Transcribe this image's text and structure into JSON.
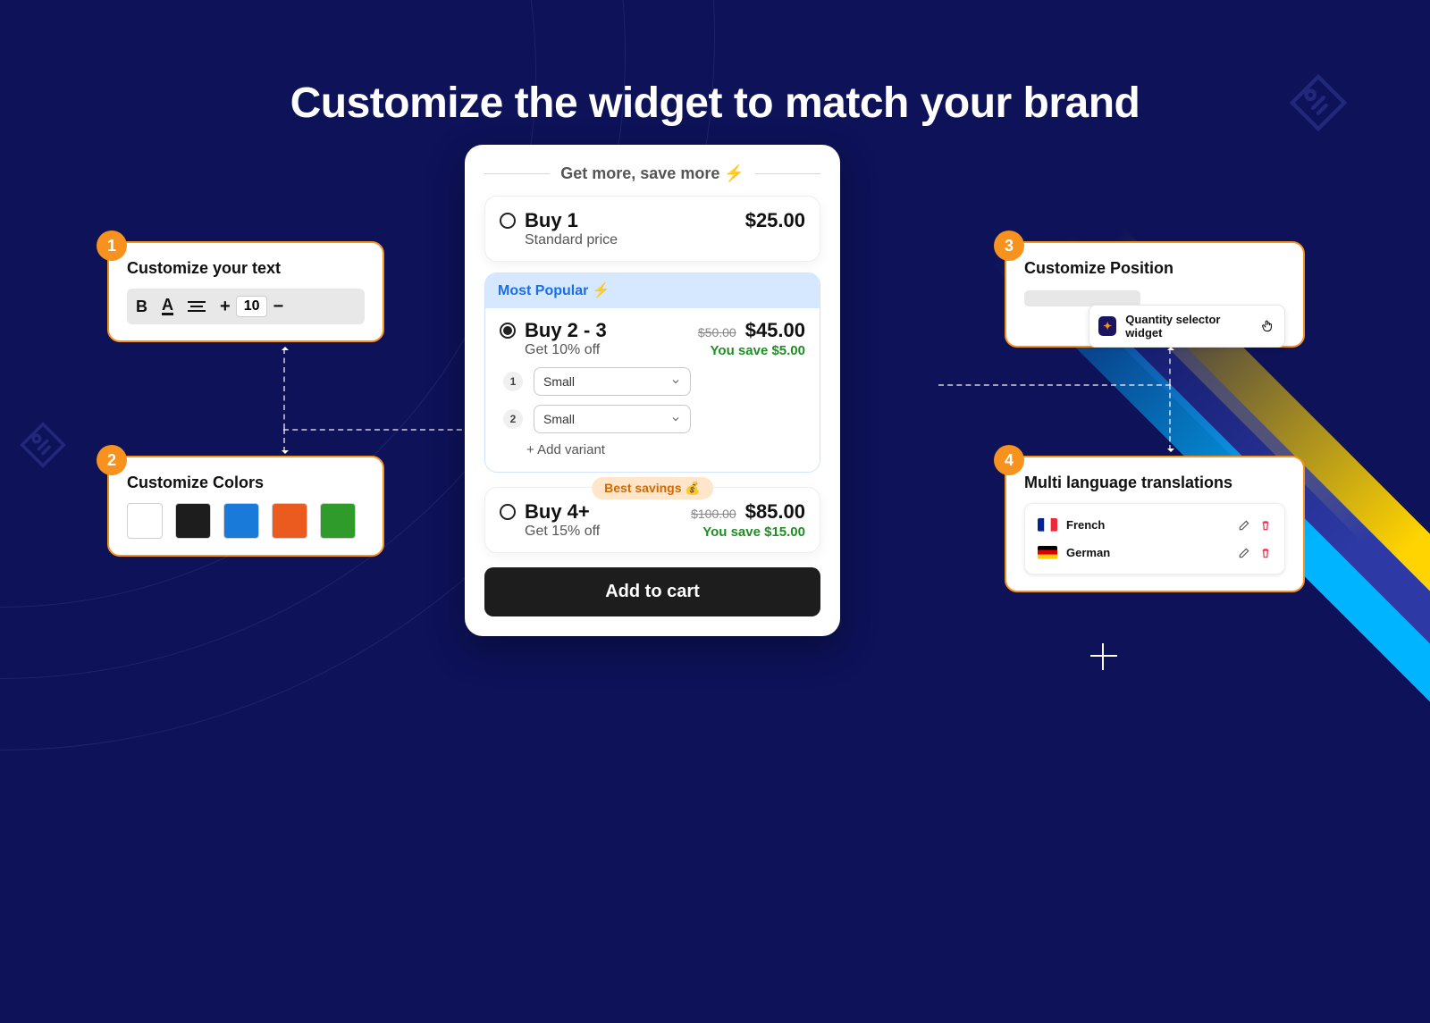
{
  "headline": "Customize the widget to match your brand",
  "callouts": {
    "c1": {
      "num": "1",
      "title": "Customize your text",
      "size_value": "10"
    },
    "c2": {
      "num": "2",
      "title": "Customize Colors",
      "swatches": [
        "#ffffff",
        "#1d1d1d",
        "#1a7ad9",
        "#eb5a1f",
        "#2e9b2a"
      ]
    },
    "c3": {
      "num": "3",
      "title": "Customize Position",
      "chip_label": "Quantity selector widget"
    },
    "c4": {
      "num": "4",
      "title": "Multi language translations",
      "langs": [
        {
          "name": "French"
        },
        {
          "name": "German"
        }
      ]
    }
  },
  "widget": {
    "title": "Get more, save more ⚡",
    "tiers": [
      {
        "title": "Buy 1",
        "sub": "Standard price",
        "price": "$25.00"
      },
      {
        "banner": "Most Popular ⚡",
        "title": "Buy 2 - 3",
        "sub": "Get 10% off",
        "strike": "$50.00",
        "price": "$45.00",
        "save": "You save $5.00",
        "variants": [
          {
            "idx": "1",
            "value": "Small"
          },
          {
            "idx": "2",
            "value": "Small"
          }
        ],
        "add_variant": "+ Add variant"
      },
      {
        "badge": "Best savings 💰",
        "title": "Buy 4+",
        "sub": "Get 15% off",
        "strike": "$100.00",
        "price": "$85.00",
        "save": "You save $15.00"
      }
    ],
    "cta": "Add to cart"
  }
}
